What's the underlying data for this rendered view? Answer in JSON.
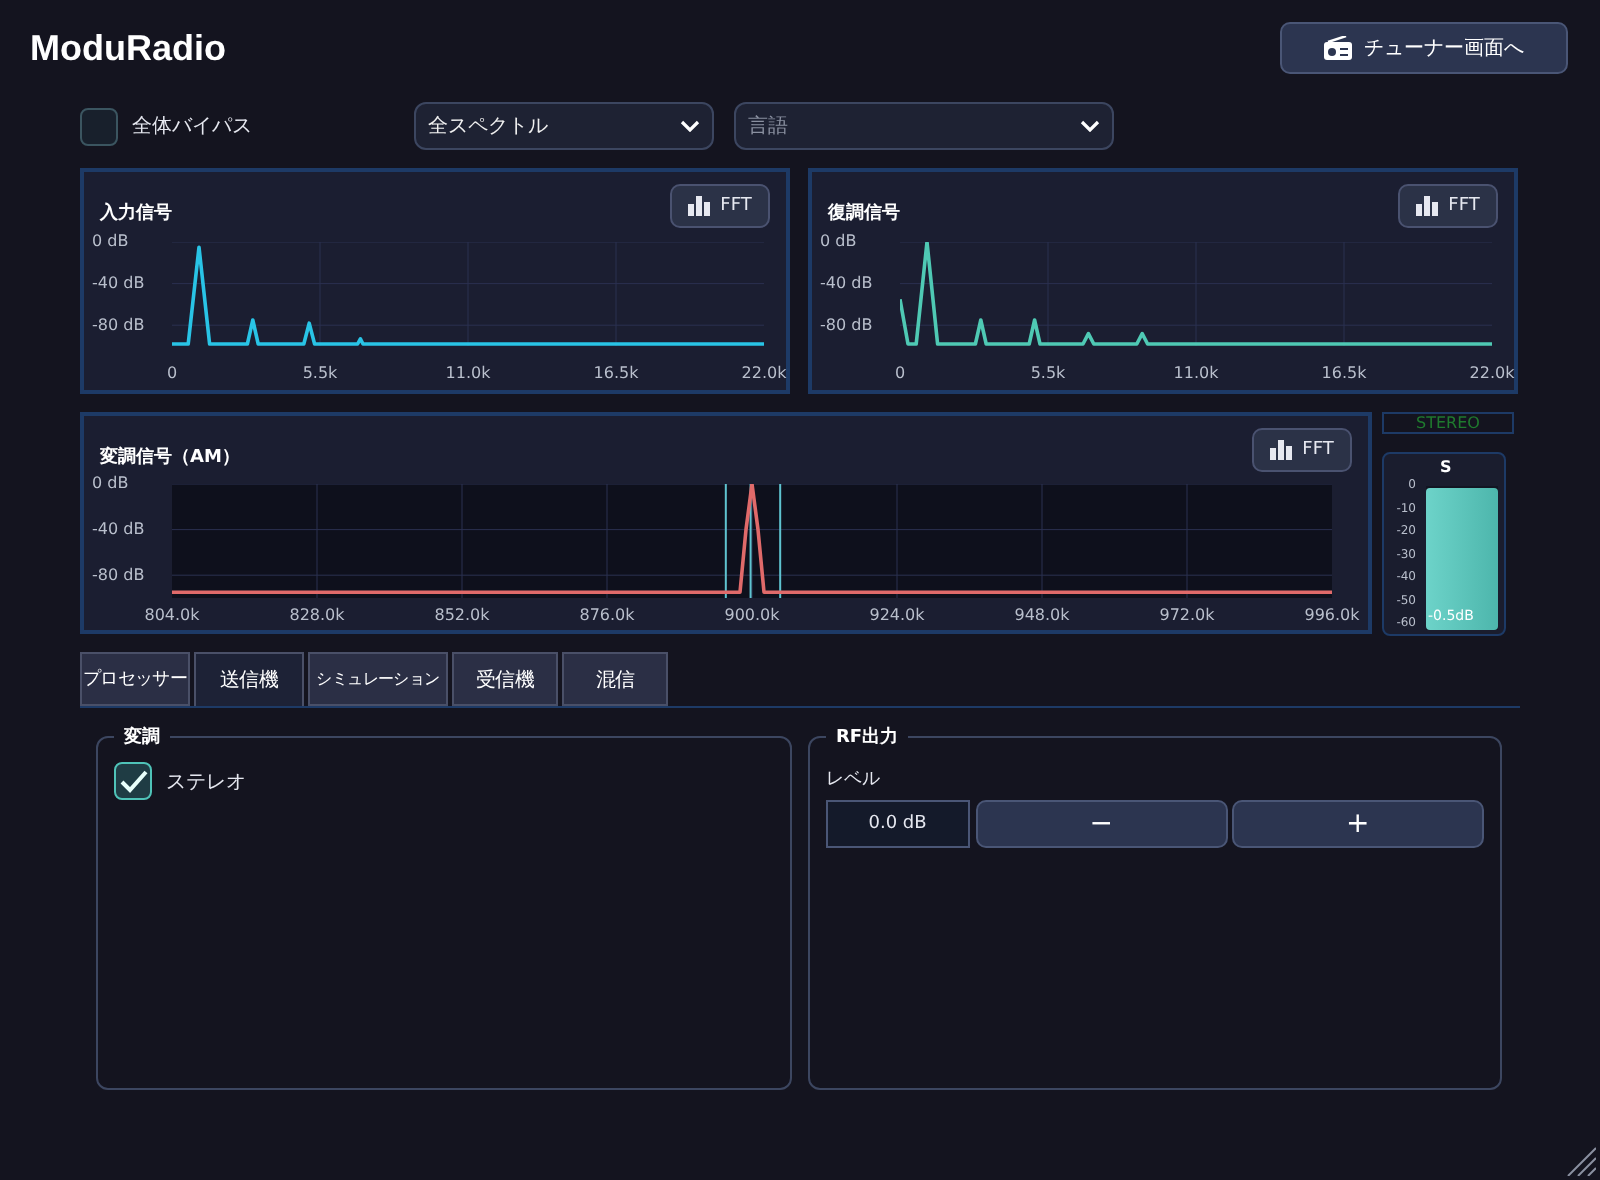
{
  "app_title": "ModuRadio",
  "tuner_button": {
    "label": "チューナー画面へ"
  },
  "bypass": {
    "label": "全体バイパス",
    "checked": false
  },
  "spectrum_select": {
    "value": "全スペクトル"
  },
  "language_select": {
    "placeholder": "言語"
  },
  "spectra": [
    {
      "title": "入力信号",
      "fft_label": "FFT",
      "chart_data": {
        "type": "line",
        "grid": true,
        "xlim": [
          0,
          22000
        ],
        "ylim": [
          -100,
          0
        ],
        "xticks": [
          {
            "value": 0,
            "label": "0"
          },
          {
            "value": 5500,
            "label": "5.5k"
          },
          {
            "value": 11000,
            "label": "11.0k"
          },
          {
            "value": 16500,
            "label": "16.5k"
          },
          {
            "value": 22000,
            "label": "22.0k"
          }
        ],
        "yticks": [
          {
            "value": 0,
            "label": "0 dB"
          },
          {
            "value": -40,
            "label": "-40 dB"
          },
          {
            "value": -80,
            "label": "-80 dB"
          }
        ],
        "x": [
          0,
          600,
          1000,
          1400,
          2800,
          3000,
          3200,
          4900,
          5100,
          5300,
          6900,
          7000,
          7100,
          22000
        ],
        "series": [
          {
            "color": "#29c4e6",
            "values": [
              -98,
              -98,
              -5,
              -98,
              -98,
              -75,
              -98,
              -98,
              -78,
              -98,
              -98,
              -93,
              -98,
              -98
            ]
          }
        ]
      }
    },
    {
      "title": "復調信号",
      "fft_label": "FFT",
      "chart_data": {
        "type": "line",
        "grid": true,
        "xlim": [
          0,
          22000
        ],
        "ylim": [
          -100,
          0
        ],
        "xticks": [
          {
            "value": 0,
            "label": "0"
          },
          {
            "value": 5500,
            "label": "5.5k"
          },
          {
            "value": 11000,
            "label": "11.0k"
          },
          {
            "value": 16500,
            "label": "16.5k"
          },
          {
            "value": 22000,
            "label": "22.0k"
          }
        ],
        "yticks": [
          {
            "value": 0,
            "label": "0 dB"
          },
          {
            "value": -40,
            "label": "-40 dB"
          },
          {
            "value": -80,
            "label": "-80 dB"
          }
        ],
        "x": [
          0,
          300,
          600,
          1000,
          1400,
          2800,
          3000,
          3200,
          4800,
          5000,
          5200,
          6800,
          7000,
          7200,
          8800,
          9000,
          9200,
          22000
        ],
        "series": [
          {
            "color": "#4fc9b4",
            "values": [
              -55,
              -98,
              -98,
              0,
              -98,
              -98,
              -75,
              -98,
              -98,
              -75,
              -98,
              -98,
              -88,
              -98,
              -98,
              -88,
              -98,
              -98
            ]
          }
        ]
      }
    }
  ],
  "modulated": {
    "title": "変調信号（AM）",
    "fft_label": "FFT",
    "chart_data": {
      "type": "line",
      "grid": true,
      "ref_lines": [
        {
          "axis": "x",
          "value": 895500,
          "color": "#5fc3d0"
        },
        {
          "axis": "x",
          "value": 899600,
          "color": "#5fc3d0"
        },
        {
          "axis": "x",
          "value": 904500,
          "color": "#5fc3d0"
        }
      ],
      "xlim": [
        804000,
        996000
      ],
      "ylim": [
        -100,
        0
      ],
      "xticks": [
        {
          "value": 804000,
          "label": "804.0k"
        },
        {
          "value": 828000,
          "label": "828.0k"
        },
        {
          "value": 852000,
          "label": "852.0k"
        },
        {
          "value": 876000,
          "label": "876.0k"
        },
        {
          "value": 900000,
          "label": "900.0k"
        },
        {
          "value": 924000,
          "label": "924.0k"
        },
        {
          "value": 948000,
          "label": "948.0k"
        },
        {
          "value": 972000,
          "label": "972.0k"
        },
        {
          "value": 996000,
          "label": "996.0k"
        }
      ],
      "yticks": [
        {
          "value": 0,
          "label": "0 dB"
        },
        {
          "value": -40,
          "label": "-40 dB"
        },
        {
          "value": -80,
          "label": "-80 dB"
        }
      ],
      "x": [
        804000,
        898000,
        899000,
        900000,
        901000,
        902000,
        996000
      ],
      "series": [
        {
          "color": "#e06a6a",
          "values": [
            -95,
            -95,
            -40,
            0,
            -40,
            -95,
            -95
          ]
        }
      ]
    }
  },
  "stereo_indicator": {
    "label": "STEREO",
    "on": false
  },
  "meter": {
    "channel": "S",
    "scale": [
      "0",
      "-10",
      "-20",
      "-30",
      "-40",
      "-50",
      "-60"
    ],
    "level": 0.98,
    "reading": "-0.5dB"
  },
  "tabs": [
    {
      "label": "プロセッサー",
      "selected": false
    },
    {
      "label": "送信機",
      "selected": true
    },
    {
      "label": "シミュレーション",
      "selected": false
    },
    {
      "label": "受信機",
      "selected": false
    },
    {
      "label": "混信",
      "selected": false
    }
  ],
  "modulation_group": {
    "title": "変調",
    "stereo_checkbox": {
      "label": "ステレオ",
      "checked": true
    }
  },
  "rf_group": {
    "title": "RF出力",
    "level_label": "レベル",
    "level_value": "0.0 dB",
    "minus_label": "−",
    "plus_label": "+"
  }
}
